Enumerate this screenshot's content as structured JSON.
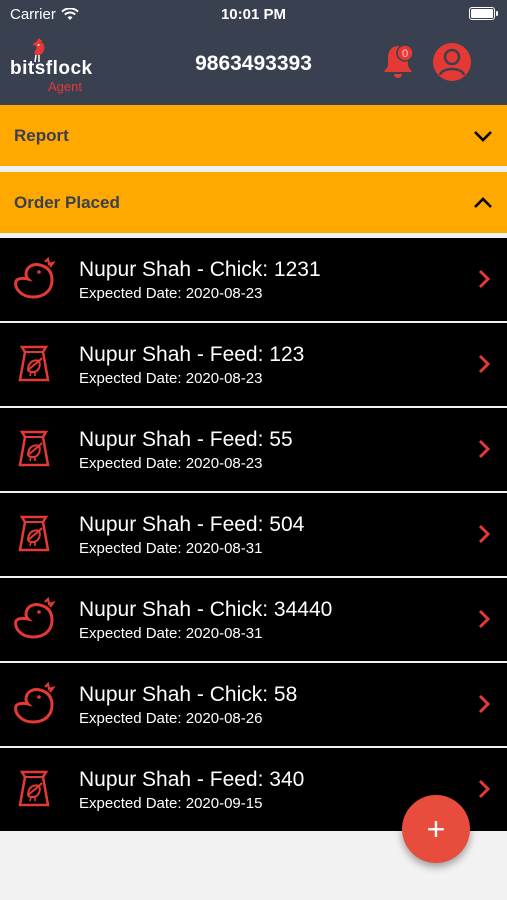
{
  "status_bar": {
    "carrier": "Carrier",
    "time": "10:01 PM"
  },
  "header": {
    "brand": "bitsflock",
    "brand_sub": "Agent",
    "phone": "9863493393",
    "notification_badge": "0",
    "icons": {
      "bell": "bell-icon",
      "profile": "profile-icon"
    }
  },
  "sections": {
    "report": {
      "label": "Report",
      "state": "collapsed"
    },
    "order_placed": {
      "label": "Order Placed",
      "state": "expanded"
    }
  },
  "orders": [
    {
      "title": "Nupur Shah - Chick: 1231",
      "subtitle": "Expected Date: 2020-08-23",
      "icon": "chick-icon"
    },
    {
      "title": "Nupur Shah - Feed: 123",
      "subtitle": "Expected Date: 2020-08-23",
      "icon": "feed-bag-icon"
    },
    {
      "title": "Nupur Shah - Feed: 55",
      "subtitle": "Expected Date: 2020-08-23",
      "icon": "feed-bag-icon"
    },
    {
      "title": "Nupur Shah - Feed: 504",
      "subtitle": "Expected Date: 2020-08-31",
      "icon": "feed-bag-icon"
    },
    {
      "title": "Nupur Shah - Chick: 34440",
      "subtitle": "Expected Date: 2020-08-31",
      "icon": "chick-icon"
    },
    {
      "title": "Nupur Shah - Chick: 58",
      "subtitle": "Expected Date: 2020-08-26",
      "icon": "chick-icon"
    },
    {
      "title": "Nupur Shah - Feed: 340",
      "subtitle": "Expected Date: 2020-09-15",
      "icon": "feed-bag-icon"
    }
  ],
  "fab": {
    "label": "+"
  },
  "colors": {
    "header_bg": "#394150",
    "section_bg": "#ffa800",
    "list_bg": "#000000",
    "accent_red": "#e53935",
    "fab_bg": "#e84c3d"
  }
}
